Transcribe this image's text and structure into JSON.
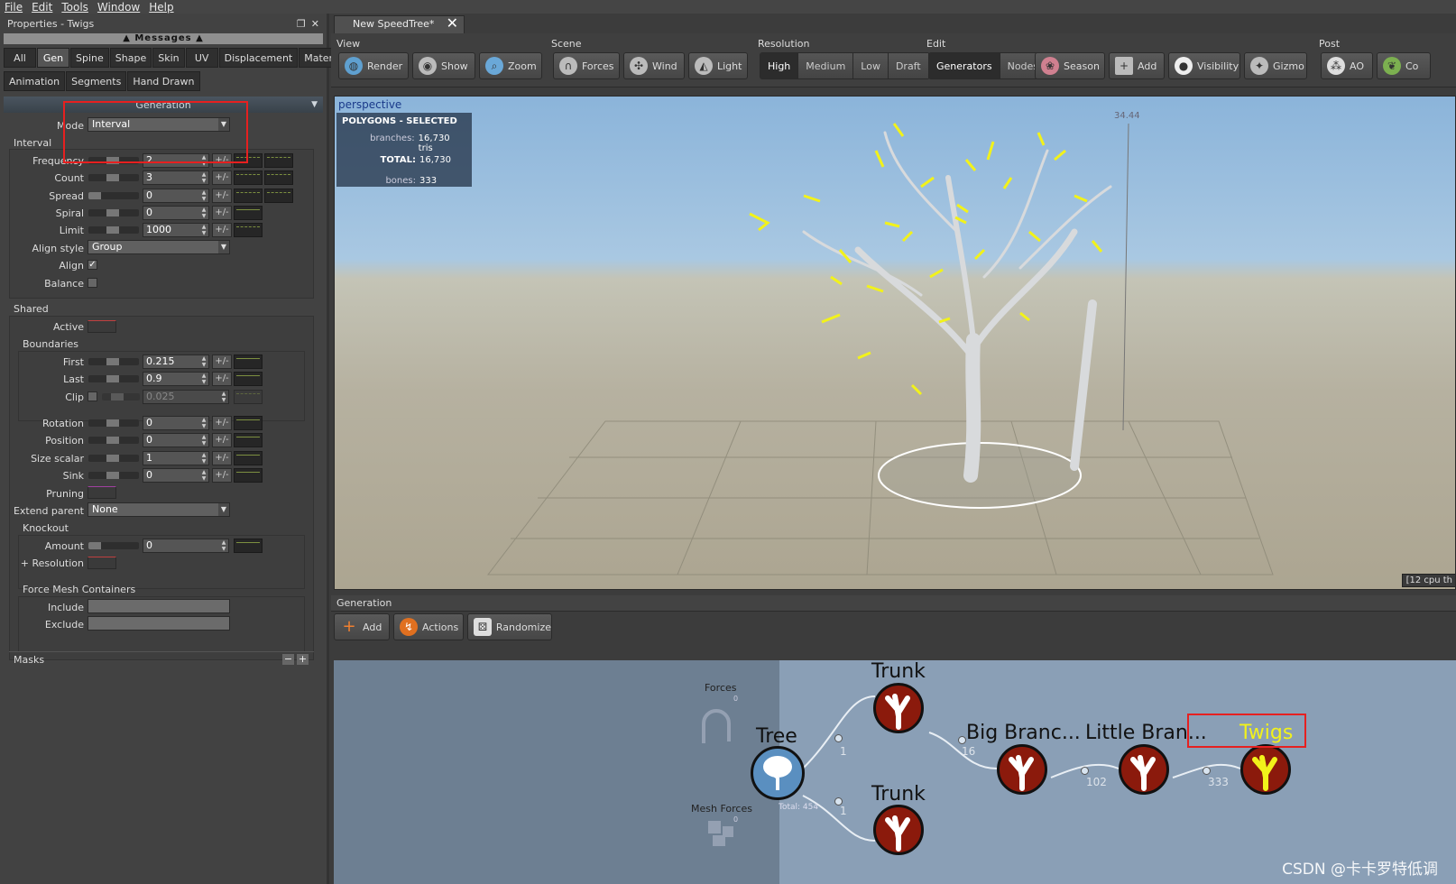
{
  "menu": [
    "File",
    "Edit",
    "Tools",
    "Window",
    "Help"
  ],
  "left_panel": {
    "title": "Properties - Twigs",
    "messages": "Messages",
    "tabs_row1": [
      "All",
      "Gen",
      "Spine",
      "Shape",
      "Skin",
      "UV",
      "Displacement",
      "Material"
    ],
    "tabs_row2": [
      "Animation",
      "Segments",
      "Hand Drawn"
    ],
    "active_tab": "Gen",
    "section": "Generation",
    "mode_label": "Mode",
    "mode_value": "Interval",
    "interval_label": "Interval",
    "frequency_label": "Frequency",
    "frequency_value": "2",
    "count_label": "Count",
    "count_value": "3",
    "spread_label": "Spread",
    "spread_value": "0",
    "spiral_label": "Spiral",
    "spiral_value": "0",
    "limit_label": "Limit",
    "limit_value": "1000",
    "align_style_label": "Align style",
    "align_style_value": "Group",
    "align_label": "Align",
    "balance_label": "Balance",
    "shared_label": "Shared",
    "active_label": "Active",
    "boundaries_label": "Boundaries",
    "first_label": "First",
    "first_value": "0.215",
    "last_label": "Last",
    "last_value": "0.9",
    "clip_label": "Clip",
    "clip_value": "0.025",
    "rotation_label": "Rotation",
    "rotation_value": "0",
    "position_label": "Position",
    "position_value": "0",
    "size_scalar_label": "Size scalar",
    "size_scalar_value": "1",
    "sink_label": "Sink",
    "sink_value": "0",
    "pruning_label": "Pruning",
    "extend_parent_label": "Extend parent",
    "extend_parent_value": "None",
    "knockout_label": "Knockout",
    "amount_label": "Amount",
    "amount_value": "0",
    "resolution_label": "+ Resolution",
    "force_mesh_label": "Force Mesh Containers",
    "include_label": "Include",
    "exclude_label": "Exclude",
    "masks_label": "Masks",
    "pm": "+/-"
  },
  "doc_tab": "New SpeedTree*",
  "toolbar": {
    "view_label": "View",
    "render": "Render",
    "show": "Show",
    "zoom": "Zoom",
    "scene_label": "Scene",
    "forces": "Forces",
    "wind": "Wind",
    "light": "Light",
    "resolution_label": "Resolution",
    "res_options": [
      "High",
      "Medium",
      "Low",
      "Draft"
    ],
    "res_selected": "High",
    "edit_label": "Edit",
    "generators": "Generators",
    "nodes": "Nodes",
    "season": "Season",
    "add": "Add",
    "visibility": "Visibility",
    "gizmo": "Gizmo",
    "post_label": "Post",
    "ao": "AO",
    "co": "Co"
  },
  "viewport": {
    "label": "perspective",
    "stats_title": "POLYGONS - SELECTED",
    "branches_label": "branches:",
    "branches_value": "16,730 tris",
    "total_label": "TOTAL:",
    "total_value": "16,730",
    "bones_label": "bones:",
    "bones_value": "333",
    "ruler_value": "34.44",
    "cpu": "[12 cpu th"
  },
  "generation": {
    "title": "Generation",
    "add": "Add",
    "actions": "Actions",
    "randomize": "Randomize",
    "forces_label": "Forces",
    "forces_count": "0",
    "mesh_forces_label": "Mesh Forces",
    "mesh_forces_count": "0",
    "tree": "Tree",
    "total": "Total: 454",
    "trunk1": "Trunk",
    "trunk1_count": "1",
    "trunk2": "Trunk",
    "trunk2_count": "1",
    "big_branches": "Big Branc...",
    "big_count": "16",
    "little_branches": "Little Bran...",
    "little_count": "102",
    "twigs": "Twigs",
    "twigs_count": "333"
  },
  "watermark": "CSDN @卡卡罗特低调",
  "colors": {
    "highlight": "#e62020",
    "twig": "#f2f21a",
    "node": "#8b1a0c"
  }
}
